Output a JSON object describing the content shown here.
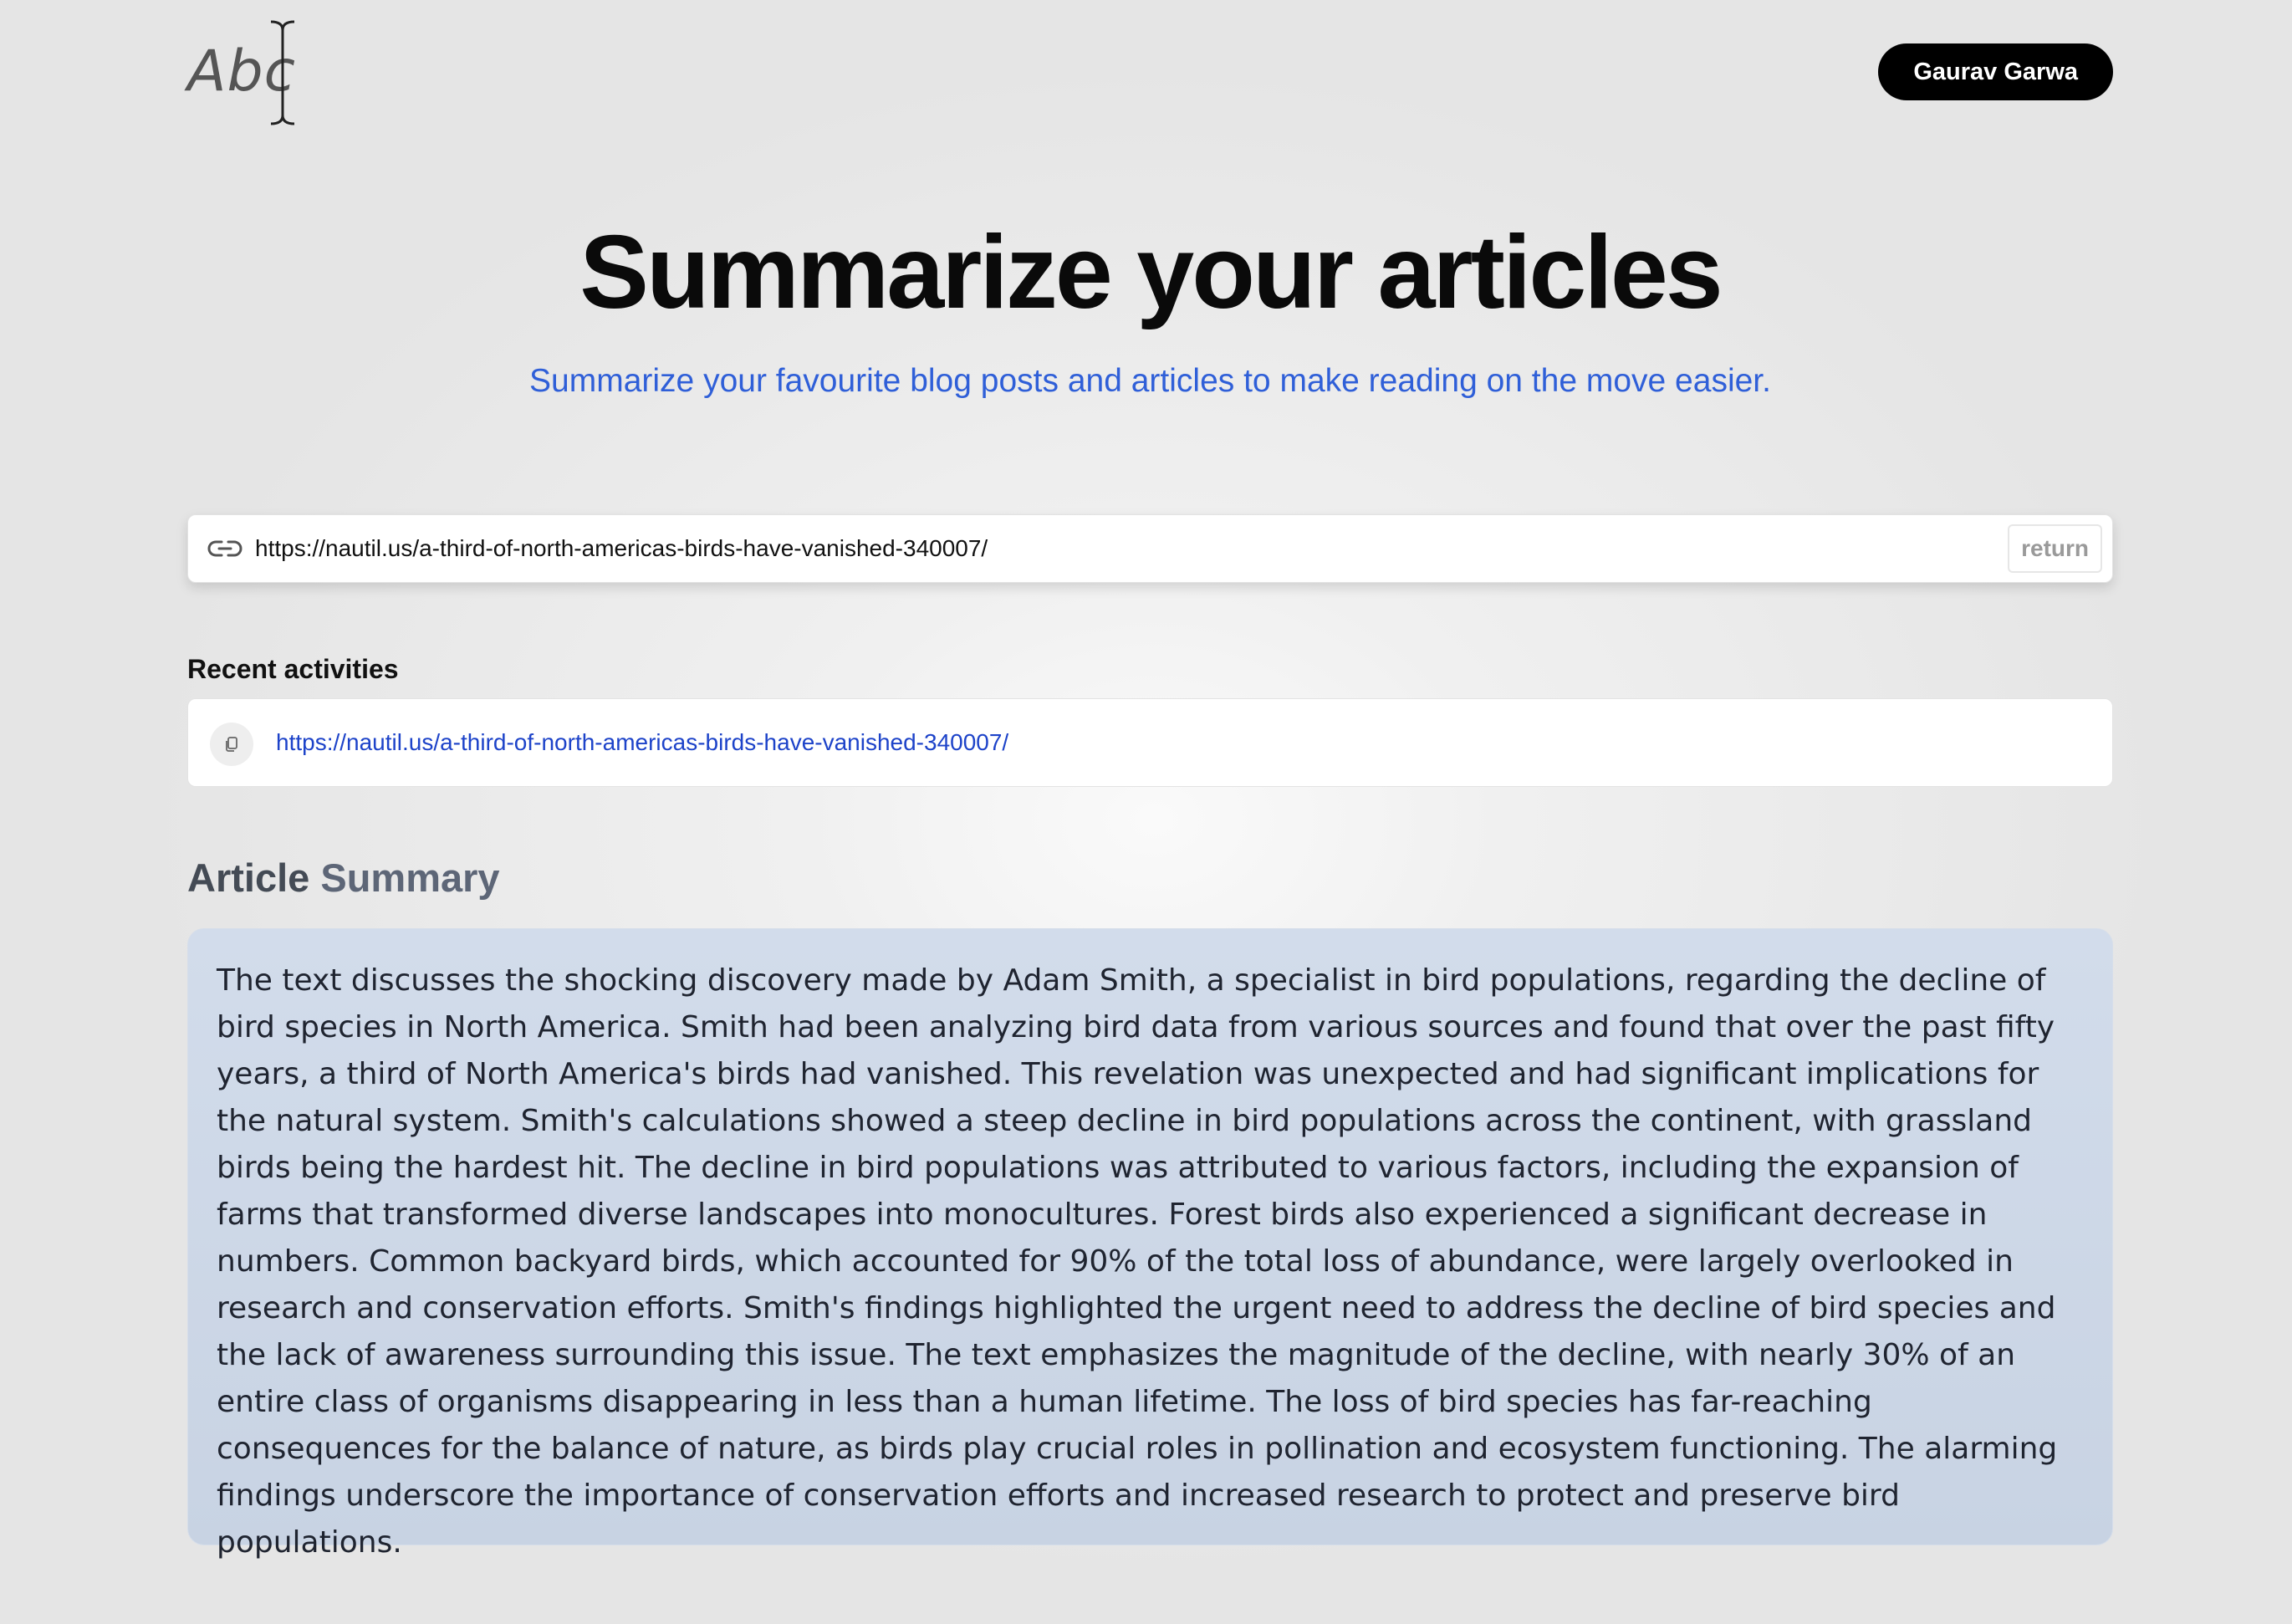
{
  "header": {
    "logo_text": "Abc",
    "user_button_label": "Gaurav Garwa"
  },
  "hero": {
    "title": "Summarize your articles",
    "subtitle": "Summarize your favourite blog posts and articles to make reading on the move easier."
  },
  "url_form": {
    "value": "https://nautil.us/a-third-of-north-americas-birds-have-vanished-340007/",
    "submit_label": "return",
    "icon": "link-icon"
  },
  "recent": {
    "title": "Recent activities",
    "items": [
      {
        "url": "https://nautil.us/a-third-of-north-americas-birds-have-vanished-340007/",
        "icon": "copy-icon"
      }
    ]
  },
  "summary": {
    "heading_word1": "Article",
    "heading_word2": "Summary",
    "text": "The text discusses the shocking discovery made by Adam Smith, a specialist in bird populations, regarding the decline of bird species in North America. Smith had been analyzing bird data from various sources and found that over the past fifty years, a third of North America's birds had vanished. This revelation was unexpected and had significant implications for the natural system. Smith's calculations showed a steep decline in bird populations across the continent, with grassland birds being the hardest hit. The decline in bird populations was attributed to various factors, including the expansion of farms that transformed diverse landscapes into monocultures. Forest birds also experienced a significant decrease in numbers. Common backyard birds, which accounted for 90% of the total loss of abundance, were largely overlooked in research and conservation efforts. Smith's findings highlighted the urgent need to address the decline of bird species and the lack of awareness surrounding this issue. The text emphasizes the magnitude of the decline, with nearly 30% of an entire class of organisms disappearing in less than a human lifetime. The loss of bird species has far-reaching consequences for the balance of nature, as birds play crucial roles in pollination and ecosystem functioning. The alarming findings underscore the importance of conservation efforts and increased research to protect and preserve bird populations."
  },
  "colors": {
    "accent_blue": "#2f5fd8",
    "link_blue": "#1d43c9",
    "summary_bg": "#ccd7e7",
    "button_black": "#000000"
  }
}
